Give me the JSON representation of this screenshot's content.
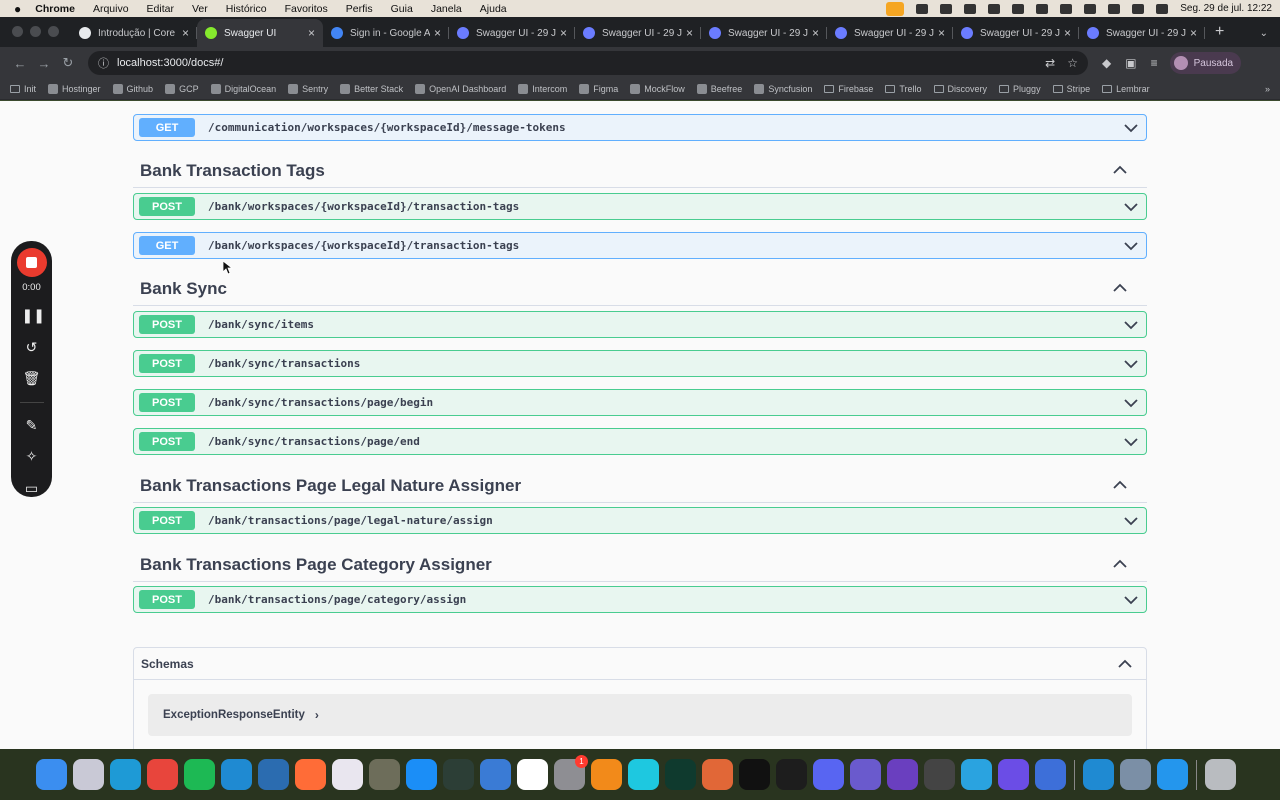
{
  "menubar": {
    "app": "Chrome",
    "items": [
      "Arquivo",
      "Editar",
      "Ver",
      "Histórico",
      "Favoritos",
      "Perfis",
      "Guia",
      "Janela",
      "Ajuda"
    ],
    "datetime": "Seg. 29 de jul.  12:22"
  },
  "tabs": [
    {
      "label": "Introdução | Core",
      "favicon_color": "#e8eaed",
      "active": false
    },
    {
      "label": "Swagger UI",
      "favicon_color": "#85ea2d",
      "active": true
    },
    {
      "label": "Sign in - Google A",
      "favicon_color": "#4285f4",
      "active": false
    },
    {
      "label": "Swagger UI - 29 J",
      "favicon_color": "#6b7cff",
      "active": false
    },
    {
      "label": "Swagger UI - 29 J",
      "favicon_color": "#6b7cff",
      "active": false
    },
    {
      "label": "Swagger UI - 29 J",
      "favicon_color": "#6b7cff",
      "active": false
    },
    {
      "label": "Swagger UI - 29 J",
      "favicon_color": "#6b7cff",
      "active": false
    },
    {
      "label": "Swagger UI - 29 J",
      "favicon_color": "#6b7cff",
      "active": false
    },
    {
      "label": "Swagger UI - 29 J",
      "favicon_color": "#6b7cff",
      "active": false
    }
  ],
  "address": {
    "url": "localhost:3000/docs#/"
  },
  "profile": {
    "label": "Pausada"
  },
  "bookmarks": [
    {
      "label": "Init",
      "folder": true
    },
    {
      "label": "Hostinger",
      "folder": false
    },
    {
      "label": "Github",
      "folder": false
    },
    {
      "label": "GCP",
      "folder": false
    },
    {
      "label": "DigitalOcean",
      "folder": false
    },
    {
      "label": "Sentry",
      "folder": false
    },
    {
      "label": "Better Stack",
      "folder": false
    },
    {
      "label": "OpenAI Dashboard",
      "folder": false
    },
    {
      "label": "Intercom",
      "folder": false
    },
    {
      "label": "Figma",
      "folder": false
    },
    {
      "label": "MockFlow",
      "folder": false
    },
    {
      "label": "Beefree",
      "folder": false
    },
    {
      "label": "Syncfusion",
      "folder": false
    },
    {
      "label": "Firebase",
      "folder": true
    },
    {
      "label": "Trello",
      "folder": true
    },
    {
      "label": "Discovery",
      "folder": true
    },
    {
      "label": "Pluggy",
      "folder": true
    },
    {
      "label": "Stripe",
      "folder": true
    },
    {
      "label": "Lembrar",
      "folder": true
    }
  ],
  "swagger": {
    "top_operation": {
      "method": "GET",
      "path": "/communication/workspaces/{workspaceId}/message-tokens"
    },
    "sections": [
      {
        "title": "Bank Transaction Tags",
        "operations": [
          {
            "method": "POST",
            "path": "/bank/workspaces/{workspaceId}/transaction-tags"
          },
          {
            "method": "GET",
            "path": "/bank/workspaces/{workspaceId}/transaction-tags"
          }
        ]
      },
      {
        "title": "Bank Sync",
        "operations": [
          {
            "method": "POST",
            "path": "/bank/sync/items"
          },
          {
            "method": "POST",
            "path": "/bank/sync/transactions"
          },
          {
            "method": "POST",
            "path": "/bank/sync/transactions/page/begin"
          },
          {
            "method": "POST",
            "path": "/bank/sync/transactions/page/end"
          }
        ]
      },
      {
        "title": "Bank Transactions Page Legal Nature Assigner",
        "operations": [
          {
            "method": "POST",
            "path": "/bank/transactions/page/legal-nature/assign"
          }
        ]
      },
      {
        "title": "Bank Transactions Page Category Assigner",
        "operations": [
          {
            "method": "POST",
            "path": "/bank/transactions/page/category/assign"
          }
        ]
      }
    ],
    "schemas": {
      "title": "Schemas",
      "items": [
        "ExceptionResponseEntity"
      ]
    }
  },
  "recorder": {
    "time": "0:00"
  },
  "dock": {
    "apps": [
      {
        "name": "finder",
        "color": "#3b8ef0"
      },
      {
        "name": "launchpad",
        "color": "#c9c9d6"
      },
      {
        "name": "terminal-app",
        "color": "#1e9ad6"
      },
      {
        "name": "chrome",
        "color": "#e8453c"
      },
      {
        "name": "spotify",
        "color": "#1db954"
      },
      {
        "name": "vscode",
        "color": "#1f8ad2"
      },
      {
        "name": "azure-data-studio",
        "color": "#2b6cb0"
      },
      {
        "name": "postman",
        "color": "#ff6c37"
      },
      {
        "name": "slack",
        "color": "#e9e6ef"
      },
      {
        "name": "gimp",
        "color": "#6d6d5a"
      },
      {
        "name": "app-store",
        "color": "#1b8ef7"
      },
      {
        "name": "activity-monitor",
        "color": "#2c3e36"
      },
      {
        "name": "xcode-instruments",
        "color": "#3a7bd5"
      },
      {
        "name": "notion",
        "color": "#ffffff"
      },
      {
        "name": "system-settings",
        "color": "#8e8e93",
        "badge": "1"
      },
      {
        "name": "fusion-360",
        "color": "#f28a1a"
      },
      {
        "name": "cursor",
        "color": "#1ec8e0"
      },
      {
        "name": "mongodb-compass",
        "color": "#0f3a2e"
      },
      {
        "name": "matlab",
        "color": "#e16737"
      },
      {
        "name": "intellij",
        "color": "#111111"
      },
      {
        "name": "datagrip",
        "color": "#1d1d1d"
      },
      {
        "name": "discord",
        "color": "#5865f2"
      },
      {
        "name": "kubernetes-lens",
        "color": "#6a5acd"
      },
      {
        "name": "orbstack",
        "color": "#6a3fbf"
      },
      {
        "name": "unity",
        "color": "#444444"
      },
      {
        "name": "telegram",
        "color": "#2aa3e0"
      },
      {
        "name": "screen-recorder",
        "color": "#6b4de6"
      },
      {
        "name": "ollama",
        "color": "#3d6fd9"
      },
      {
        "name": "vscode-2",
        "color": "#1f8ad2"
      },
      {
        "name": "preview",
        "color": "#7b8fa6"
      },
      {
        "name": "docker",
        "color": "#2496ed"
      },
      {
        "name": "trash",
        "color": "#b9bcc0"
      }
    ]
  }
}
